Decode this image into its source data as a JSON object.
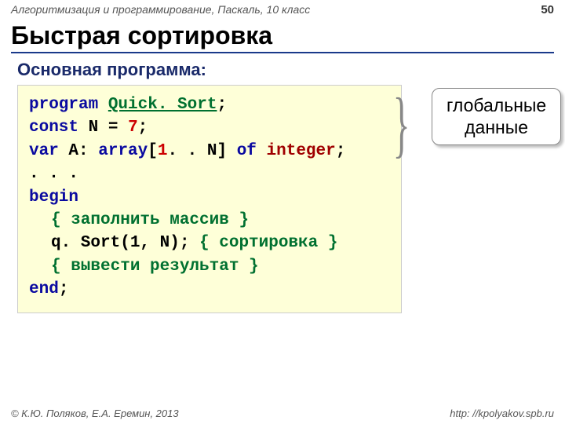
{
  "header": {
    "course": "Алгоритмизация и программирование, Паскаль, 10 класс",
    "page": "50"
  },
  "title": "Быстрая сортировка",
  "subtitle": "Основная программа:",
  "code": {
    "kw_program": "program",
    "name": "Quick. Sort",
    "semi": ";",
    "kw_const": "const",
    "const_name": "N",
    "eq": "=",
    "const_val": "7",
    "kw_var": "var",
    "var_decl_head": "A: ",
    "kw_array": "array",
    "arr_open": "[",
    "one": "1",
    "range": ". . N] ",
    "kw_of": "of",
    "sp": " ",
    "ty_int": "integer",
    "dots": ". . .",
    "kw_begin": "begin",
    "c_fill": "{ заполнить массив }",
    "call": "q. Sort(1, N); ",
    "c_sort": "{ сортировка }",
    "c_out": "{ вывести результат }",
    "kw_end": "end",
    "end_semi": ";"
  },
  "callout": {
    "line1": "глобальные",
    "line2": "данные"
  },
  "footer": {
    "copyright": "© К.Ю. Поляков, Е.А. Еремин, 2013",
    "url": "http: //kpolyakov.spb.ru"
  }
}
